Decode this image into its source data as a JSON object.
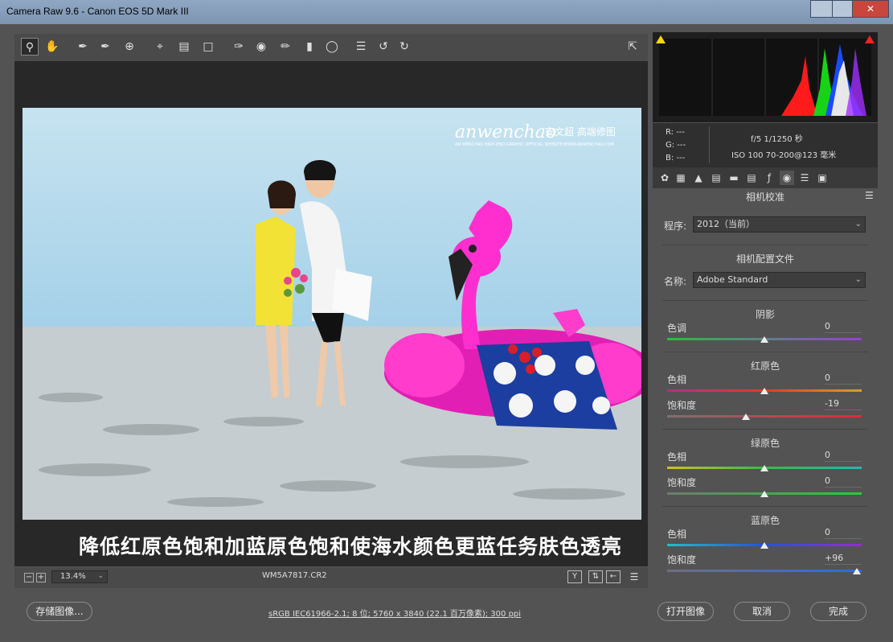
{
  "window": {
    "title": "Camera Raw 9.6 -  Canon EOS 5D Mark III",
    "close_label": "✕"
  },
  "toolbar": {
    "icons": [
      "zoom-icon",
      "hand-icon",
      "white-balance-icon",
      "color-sampler-icon",
      "targeted-adjustment-icon",
      "crop-icon",
      "straighten-icon",
      "transform-icon",
      "spot-removal-icon",
      "red-eye-icon",
      "adjustment-brush-icon",
      "graduated-filter-icon",
      "radial-filter-icon",
      "preferences-icon",
      "rotate-ccw-icon",
      "rotate-cw-icon"
    ]
  },
  "photo": {
    "watermark_brand": "anwenchao",
    "watermark_cn": "安文超 高端修图",
    "watermark_sub": "AN WENCHAO HIGH-END GRAPHIC OFFICIAL WEBSITE/WWW.ANWENCHAO.COM",
    "caption": "降低红原色饱和加蓝原色饱和使海水颜色更蓝任务肤色透亮"
  },
  "statusbar": {
    "zoom": "13.4%",
    "filename": "WM5A7817.CR2"
  },
  "readout": {
    "r": "R:  ---",
    "g": "G:  ---",
    "b": "B:  ---",
    "exposure": "f/5   1/1250 秒",
    "iso_lens": "ISO 100   70-200@123 毫米"
  },
  "panel": {
    "title": "相机校准",
    "process_label": "程序:",
    "process_value": "2012（当前）",
    "profile_header": "相机配置文件",
    "name_label": "名称:",
    "name_value": "Adobe Standard",
    "shadows": {
      "header": "阴影",
      "tint_label": "色调",
      "tint_value": "0"
    },
    "red": {
      "header": "红原色",
      "hue_label": "色相",
      "hue_value": "0",
      "sat_label": "饱和度",
      "sat_value": "-19"
    },
    "green": {
      "header": "绿原色",
      "hue_label": "色相",
      "hue_value": "0",
      "sat_label": "饱和度",
      "sat_value": "0"
    },
    "blue": {
      "header": "蓝原色",
      "hue_label": "色相",
      "hue_value": "0",
      "sat_label": "饱和度",
      "sat_value": "+96"
    }
  },
  "bottom": {
    "save_label": "存储图像...",
    "file_info": "sRGB IEC61966-2.1; 8 位; 5760 x 3840 (22.1 百万像素); 300 ppi",
    "open_label": "打开图像",
    "cancel_label": "取消",
    "done_label": "完成"
  }
}
